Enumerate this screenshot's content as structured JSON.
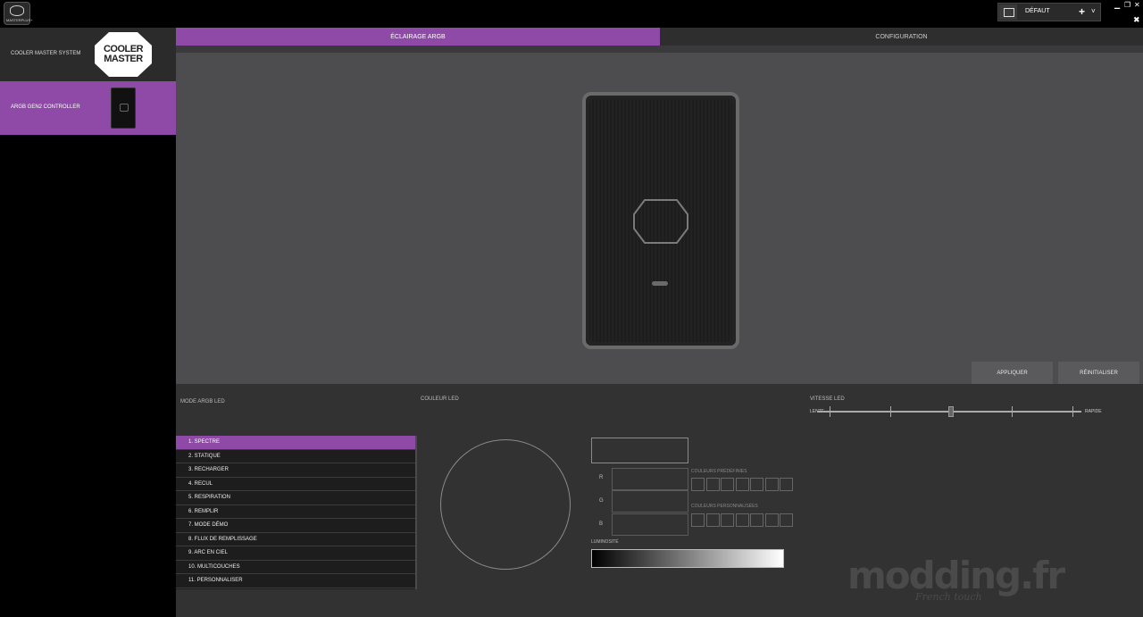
{
  "titlebar": {
    "app_logo_label": "MASTERPLUS+",
    "profile": {
      "name": "DÉFAUT",
      "add": "+",
      "chevron": "˅"
    },
    "window": {
      "minimize": "▁",
      "restore": "❐",
      "close": "✕"
    }
  },
  "sidebar": {
    "items": [
      {
        "label": "COOLER MASTER SYSTEM",
        "logo_lines": [
          "COOLER",
          "MASTER"
        ]
      },
      {
        "label": "ARGB GEN2 CONTROLLER"
      }
    ]
  },
  "tabs": [
    {
      "label": "ÉCLAIRAGE ARGB",
      "active": true
    },
    {
      "label": "CONFIGURATION",
      "active": false
    }
  ],
  "actions": {
    "apply": "APPLIQUER",
    "reset": "RÉINITIALISER"
  },
  "panel": {
    "mode_header": "MODE ARGB LED",
    "color_header": "COULEUR LED",
    "speed_header": "VITESSE LED",
    "speed_slow": "LENTE",
    "speed_fast": "RAPIDE",
    "speed_level": 3,
    "speed_steps": 5,
    "preset_header": "COULEURS PRÉDÉFINIES",
    "custom_header": "COULEURS PERSONNALISÉES",
    "brightness_label": "LUMINOSITÉ",
    "rgb_labels": [
      "R",
      "G",
      "B"
    ],
    "accent_color": "#8e4aa6",
    "modes": [
      "1. SPECTRE",
      "2. STATIQUE",
      "3. RECHARGER",
      "4. RECUL",
      "5. RESPIRATION",
      "6. REMPLIR",
      "7. MODE DÉMO",
      "8. FLUX DE REMPLISSAGE",
      "9. ARC EN CIEL",
      "10. MULTICOUCHES",
      "11. PERSONNALISER"
    ],
    "selected_mode_index": 0
  },
  "watermark": {
    "title": "modding.fr",
    "subtitle": "French touch"
  }
}
